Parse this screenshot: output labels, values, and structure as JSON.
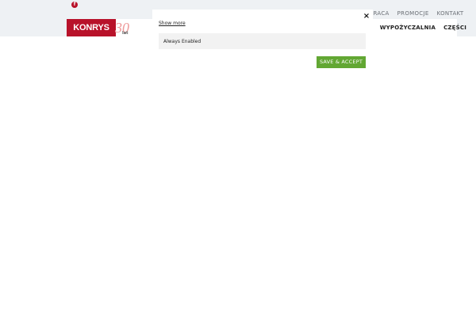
{
  "topbar": {
    "facebook_glyph": "f",
    "links": [
      "PRACA",
      "PROMOCJE",
      "KONTAKT"
    ]
  },
  "header": {
    "logo_text": "KONRYS",
    "logo_anniversary": "30",
    "logo_anniversary_unit": "lat",
    "nav_caret": "▾",
    "nav_items": [
      "WYPOŻYCZALNIA",
      "CZĘŚCI"
    ]
  },
  "cookie_modal": {
    "close_glyph": "×",
    "show_more": "Show more",
    "always_enabled": "Always Enabled",
    "save_button": "SAVE & ACCEPT"
  },
  "colors": {
    "brand_red": "#b8122a",
    "accept_green": "#62a733",
    "topbar_bg": "#eef1f4"
  }
}
